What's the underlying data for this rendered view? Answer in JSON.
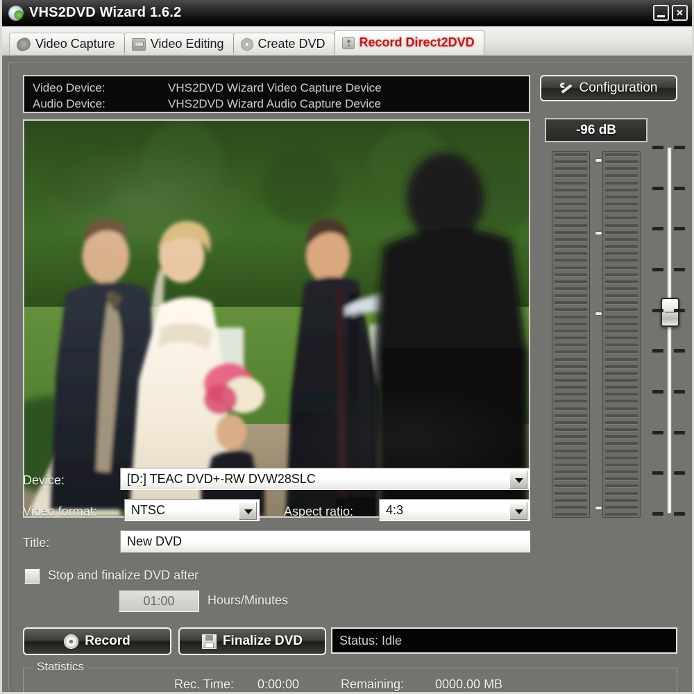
{
  "window": {
    "title": "VHS2DVD Wizard 1.6.2",
    "logo_icon": "globe-icon",
    "minimize_label": "",
    "close_label": "✕"
  },
  "tabs": [
    {
      "label": "Video Capture",
      "icon": "film-reel-icon",
      "active": false
    },
    {
      "label": "Video Editing",
      "icon": "video-tape-icon",
      "active": false
    },
    {
      "label": "Create DVD",
      "icon": "disc-icon",
      "active": false
    },
    {
      "label": "Record Direct2DVD",
      "icon": "recorder-icon",
      "active": true
    }
  ],
  "device_info": {
    "video_label": "Video Device:",
    "video_value": "VHS2DVD Wizard Video Capture Device",
    "audio_label": "Audio Device:",
    "audio_value": "VHS2DVD Wizard Audio Capture Device"
  },
  "configuration": {
    "label": "Configuration",
    "icon": "wrench-icon"
  },
  "audio": {
    "db_value": "-96 dB",
    "meter_channels": 2,
    "meter_segments": 52,
    "slider_ticks": 10,
    "slider_position_pct": 45
  },
  "form": {
    "device_label": "Device:",
    "device_value": "[D:] TEAC   DVD+-RW   DVW28SLC",
    "video_format_label": "Video format:",
    "video_format_value": "NTSC",
    "aspect_ratio_label": "Aspect ratio:",
    "aspect_ratio_value": "4:3",
    "title_label": "Title:",
    "title_value": "New DVD",
    "stop_finalize_label": "Stop and finalize DVD after",
    "stop_finalize_checked": false,
    "duration_value": "01:00",
    "duration_units": "Hours/Minutes"
  },
  "actions": {
    "record_label": "Record",
    "record_icon": "disc-icon",
    "finalize_label": "Finalize DVD",
    "finalize_icon": "floppy-save-icon",
    "status_text": "Status: Idle"
  },
  "statistics": {
    "group_label": "Statistics",
    "rec_time_label": "Rec. Time:",
    "rec_time_value": "0:00:00",
    "remaining_label": "Remaining:",
    "remaining_value": "0000.00 MB"
  },
  "colors": {
    "background": "#73736f",
    "accent_active_tab": "#b02020",
    "panel_dark": "#0a0a0a",
    "field_light": "#ffffff"
  }
}
